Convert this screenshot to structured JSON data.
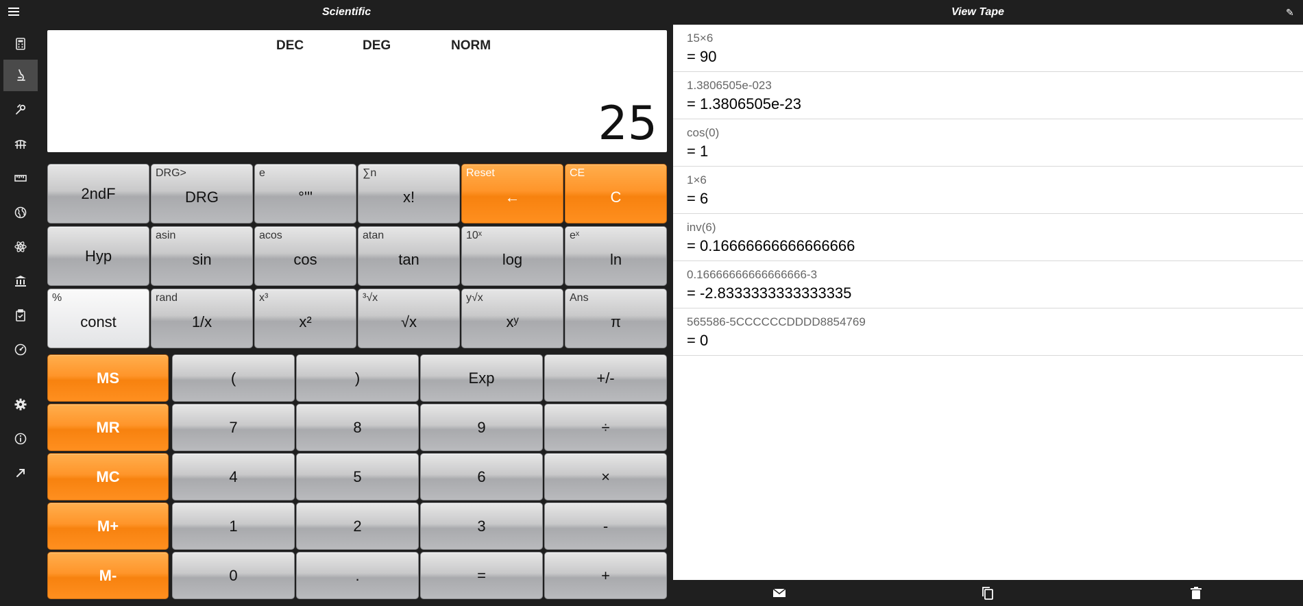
{
  "titles": {
    "left": "Scientific",
    "right": "View Tape"
  },
  "sidebar": {
    "items": [
      {
        "name": "calculator-icon"
      },
      {
        "name": "microscope-icon",
        "active": true
      },
      {
        "name": "wrench-icon"
      },
      {
        "name": "bridge-icon"
      },
      {
        "name": "ruler-icon"
      },
      {
        "name": "globe-icon"
      },
      {
        "name": "atom-icon"
      },
      {
        "name": "bank-icon"
      },
      {
        "name": "clipboard-icon"
      },
      {
        "name": "gauge-icon"
      },
      {
        "name": "gear-icon"
      },
      {
        "name": "info-icon"
      },
      {
        "name": "expand-icon"
      }
    ]
  },
  "display": {
    "modes": [
      "DEC",
      "DEG",
      "NORM"
    ],
    "value": "25"
  },
  "keys": {
    "row1": [
      {
        "sec": "",
        "main": "2ndF"
      },
      {
        "sec": "DRG>",
        "main": "DRG"
      },
      {
        "sec": "e",
        "main": "°'\""
      },
      {
        "sec": "∑n",
        "main": "x!"
      },
      {
        "sec": "Reset",
        "main": "←"
      },
      {
        "sec": "CE",
        "main": "C"
      }
    ],
    "row2": [
      {
        "sec": "",
        "main": "Hyp"
      },
      {
        "sec": "asin",
        "main": "sin"
      },
      {
        "sec": "acos",
        "main": "cos"
      },
      {
        "sec": "atan",
        "main": "tan"
      },
      {
        "sec": "10ˣ",
        "main": "log"
      },
      {
        "sec": "eˣ",
        "main": "ln"
      }
    ],
    "row3": [
      {
        "sec": "%",
        "main": "const"
      },
      {
        "sec": "rand",
        "main": "1/x"
      },
      {
        "sec": "x³",
        "main": "x²"
      },
      {
        "sec": "³√x",
        "main": "√x"
      },
      {
        "sec": "y√x",
        "main": "xʸ"
      },
      {
        "sec": "Ans",
        "main": "π"
      }
    ],
    "memory": [
      "MS",
      "MR",
      "MC",
      "M+",
      "M-"
    ],
    "pad": [
      [
        "(",
        ")",
        "Exp",
        "+/-"
      ],
      [
        "7",
        "8",
        "9",
        "÷"
      ],
      [
        "4",
        "5",
        "6",
        "×"
      ],
      [
        "1",
        "2",
        "3",
        "-"
      ],
      [
        "0",
        ".",
        "=",
        "+"
      ]
    ]
  },
  "tape": [
    {
      "expr": "15×6",
      "result": "= 90"
    },
    {
      "expr": "1.3806505e-023",
      "result": "= 1.3806505e-23"
    },
    {
      "expr": "cos(0)",
      "result": "= 1"
    },
    {
      "expr": "1×6",
      "result": "= 6"
    },
    {
      "expr": "inv(6)",
      "result": "= 0.16666666666666666"
    },
    {
      "expr": "0.16666666666666666-3",
      "result": "= -2.8333333333333335"
    },
    {
      "expr": "565586-5CCCCCCDDDD8854769",
      "result": "= 0"
    }
  ],
  "footer": [
    "mail-icon",
    "copy-icon",
    "trash-icon"
  ],
  "colors": {
    "accent": "#ff8f1f",
    "background": "#1f1f1f"
  }
}
